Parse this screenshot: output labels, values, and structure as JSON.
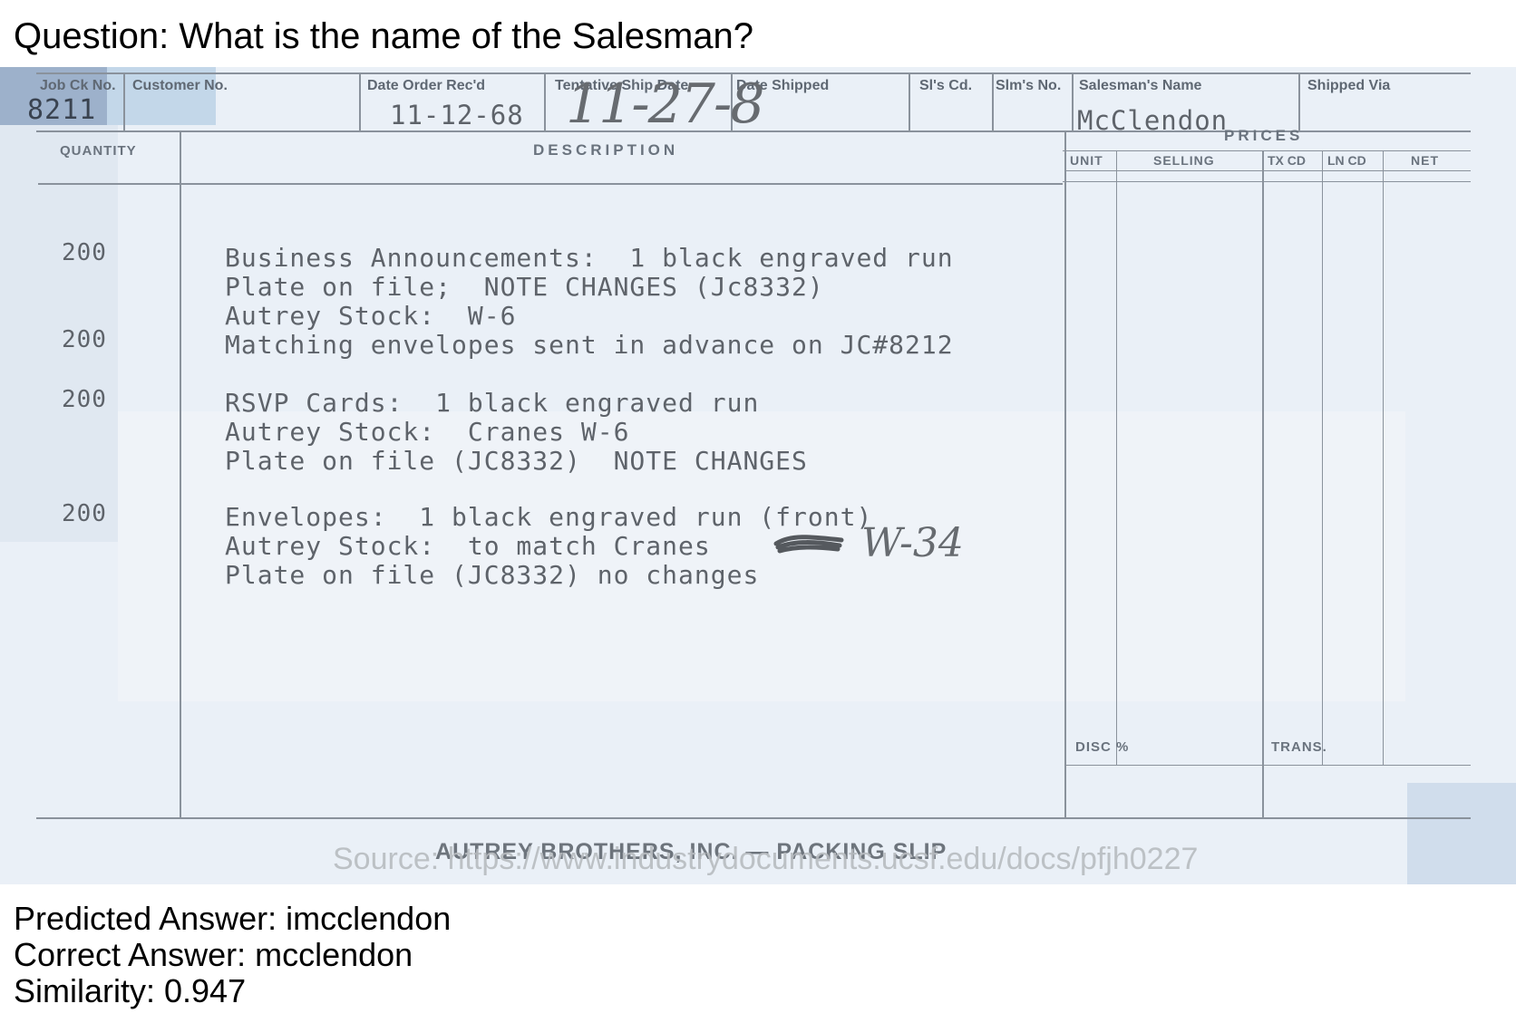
{
  "question": "Question: What is the name of the Salesman?",
  "form": {
    "headers": {
      "job_ck_no": "Job Ck No.",
      "customer_no": "Customer No.",
      "date_order_recd": "Date Order Rec'd",
      "tentative_ship_date": "Tentative Ship Date",
      "date_shipped": "Date Shipped",
      "sls_cd": "Sl's Cd.",
      "slms_no": "Slm's No.",
      "salesmans_name": "Salesman's Name",
      "shipped_via": "Shipped Via",
      "quantity": "QUANTITY",
      "description": "DESCRIPTION",
      "prices": "PRICES",
      "unit": "UNIT",
      "selling": "SELLING",
      "tx_cd": "TX CD",
      "ln_cd": "LN CD",
      "net": "NET",
      "disc": "DISC %",
      "trans": "TRANS."
    },
    "values": {
      "job_ck_no": "8211",
      "date_order_recd": "11-12-68",
      "tentative_ship_date": "11-27-8",
      "salesmans_name": "McClendon"
    },
    "items": [
      {
        "qty": "200",
        "lines": [
          "Business Announcements:  1 black engraved run",
          "Plate on file;  NOTE CHANGES (Jc8332)",
          "Autrey Stock:  W-6"
        ]
      },
      {
        "qty": "200",
        "lines": [
          "Matching envelopes sent in advance on JC#8212"
        ]
      },
      {
        "qty": "200",
        "lines": [
          "RSVP Cards:  1 black engraved run",
          "Autrey Stock:  Cranes W-6",
          "Plate on file (JC8332)  NOTE CHANGES"
        ]
      },
      {
        "qty": "200",
        "lines": [
          "Envelopes:  1 black engraved run (front)",
          "Autrey Stock:  to match Cranes",
          "Plate on file (JC8332) no changes"
        ]
      }
    ],
    "handwritten_note": "W-34",
    "footer": "AUTREY BROTHERS, INC. — PACKING SLIP"
  },
  "source": "Source: https://www.industrydocuments.ucsf.edu/docs/pfjh0227",
  "predicted_answer": "Predicted Answer: imcclendon",
  "correct_answer": "Correct Answer: mcclendon",
  "similarity": "Similarity: 0.947"
}
